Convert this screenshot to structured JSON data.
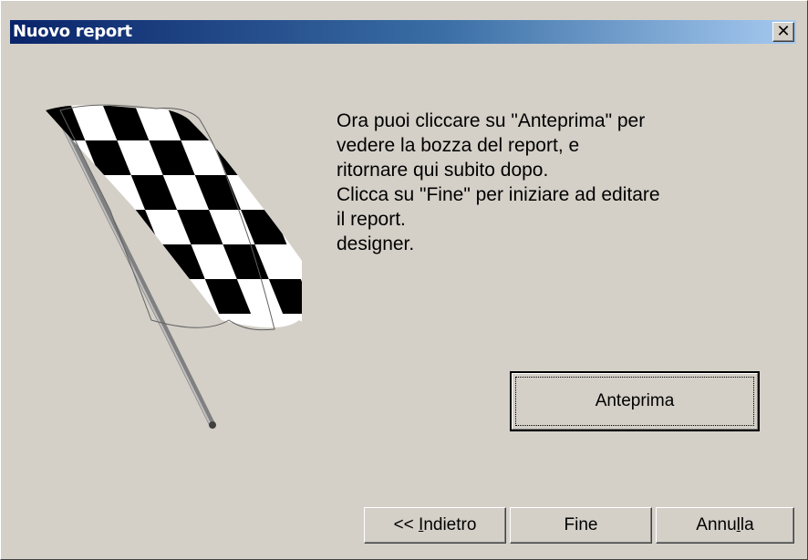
{
  "window": {
    "title": "Nuovo report",
    "close_symbol": "✕"
  },
  "illustration": {
    "icon": "checkered-flag-icon"
  },
  "message": {
    "lines": [
      "Ora puoi cliccare su \"Anteprima\" per",
      "vedere la bozza del report, e",
      "ritornare qui subito dopo.",
      "Clicca su \"Fine\" per iniziare ad editare",
      "il report.",
      "designer."
    ]
  },
  "buttons": {
    "preview": "Anteprima",
    "back_prefix": "<< ",
    "back_mnemonic": "I",
    "back_rest": "ndietro",
    "finish": "Fine",
    "cancel_pre": "Annu",
    "cancel_mnemonic": "l",
    "cancel_post": "la"
  }
}
